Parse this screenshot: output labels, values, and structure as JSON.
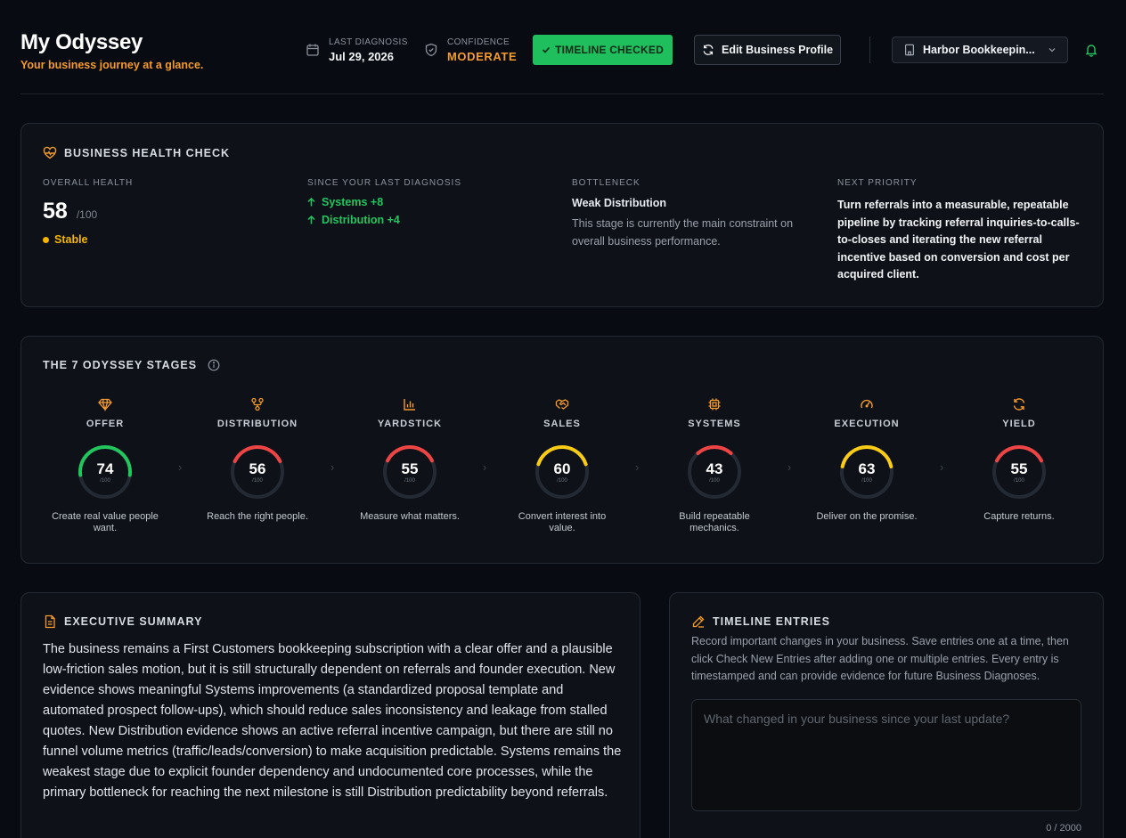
{
  "header": {
    "title": "My Odyssey",
    "subtitle": "Your business journey at a glance.",
    "last_diagnosis_label": "LAST DIAGNOSIS",
    "last_diagnosis_value": "Jul 29, 2026",
    "confidence_label": "CONFIDENCE",
    "confidence_value": "MODERATE",
    "timeline_button": "TIMELINE CHECKED",
    "edit_button": "Edit Business Profile",
    "business_select": "Harbor Bookkeepin...",
    "accent": "#f59a2c",
    "green": "#1fbf5e"
  },
  "health": {
    "title": "BUSINESS HEALTH CHECK",
    "overall_label": "OVERALL HEALTH",
    "overall_score": "58",
    "overall_max": "/100",
    "status": "Stable",
    "since_label": "SINCE YOUR LAST DIAGNOSIS",
    "deltas": [
      "Systems +8",
      "Distribution +4"
    ],
    "bottleneck_label": "BOTTLENECK",
    "bottleneck_name": "Weak Distribution",
    "bottleneck_desc": "This stage is currently the main constraint on overall business performance.",
    "next_label": "NEXT PRIORITY",
    "next_text": "Turn referrals into a measurable, repeatable pipeline by tracking referral inquiries-to-calls-to-closes and iterating the new referral incentive based on conversion and cost per acquired client."
  },
  "stages": {
    "title": "THE 7 ODYSSEY STAGES",
    "max_label": "/100",
    "items": [
      {
        "name": "OFFER",
        "score": "74",
        "value": 74,
        "color": "#22c55e",
        "desc": "Create real value people want.",
        "icon": "gem-icon"
      },
      {
        "name": "DISTRIBUTION",
        "score": "56",
        "value": 56,
        "color": "#ef4444",
        "desc": "Reach the right people.",
        "icon": "share-nodes-icon"
      },
      {
        "name": "YARDSTICK",
        "score": "55",
        "value": 55,
        "color": "#ef4444",
        "desc": "Measure what matters.",
        "icon": "bar-chart-icon"
      },
      {
        "name": "SALES",
        "score": "60",
        "value": 60,
        "color": "#facc15",
        "desc": "Convert interest into value.",
        "icon": "handshake-icon"
      },
      {
        "name": "SYSTEMS",
        "score": "43",
        "value": 43,
        "color": "#ef4444",
        "desc": "Build repeatable mechanics.",
        "icon": "chip-icon"
      },
      {
        "name": "EXECUTION",
        "score": "63",
        "value": 63,
        "color": "#facc15",
        "desc": "Deliver on the promise.",
        "icon": "gauge-icon"
      },
      {
        "name": "YIELD",
        "score": "55",
        "value": 55,
        "color": "#ef4444",
        "desc": "Capture returns.",
        "icon": "refresh-icon"
      }
    ]
  },
  "summary": {
    "title": "EXECUTIVE SUMMARY",
    "text": "The business remains a First Customers bookkeeping subscription with a clear offer and a plausible low-friction sales motion, but it is still structurally dependent on referrals and founder execution. New evidence shows meaningful Systems improvements (a standardized proposal template and automated prospect follow-ups), which should reduce sales inconsistency and leakage from stalled quotes. New Distribution evidence shows an active referral incentive campaign, but there are still no funnel volume metrics (traffic/leads/conversion) to make acquisition predictable. Systems remains the weakest stage due to explicit founder dependency and undocumented core processes, while the primary bottleneck for reaching the next milestone is still Distribution predictability beyond referrals."
  },
  "timeline": {
    "title": "TIMELINE ENTRIES",
    "desc": "Record important changes in your business. Save entries one at a time, then click Check New Entries after adding one or multiple entries. Every entry is timestamped and can provide evidence for future Business Diagnoses.",
    "placeholder": "What changed in your business since your last update?",
    "counter": "0 / 2000"
  }
}
